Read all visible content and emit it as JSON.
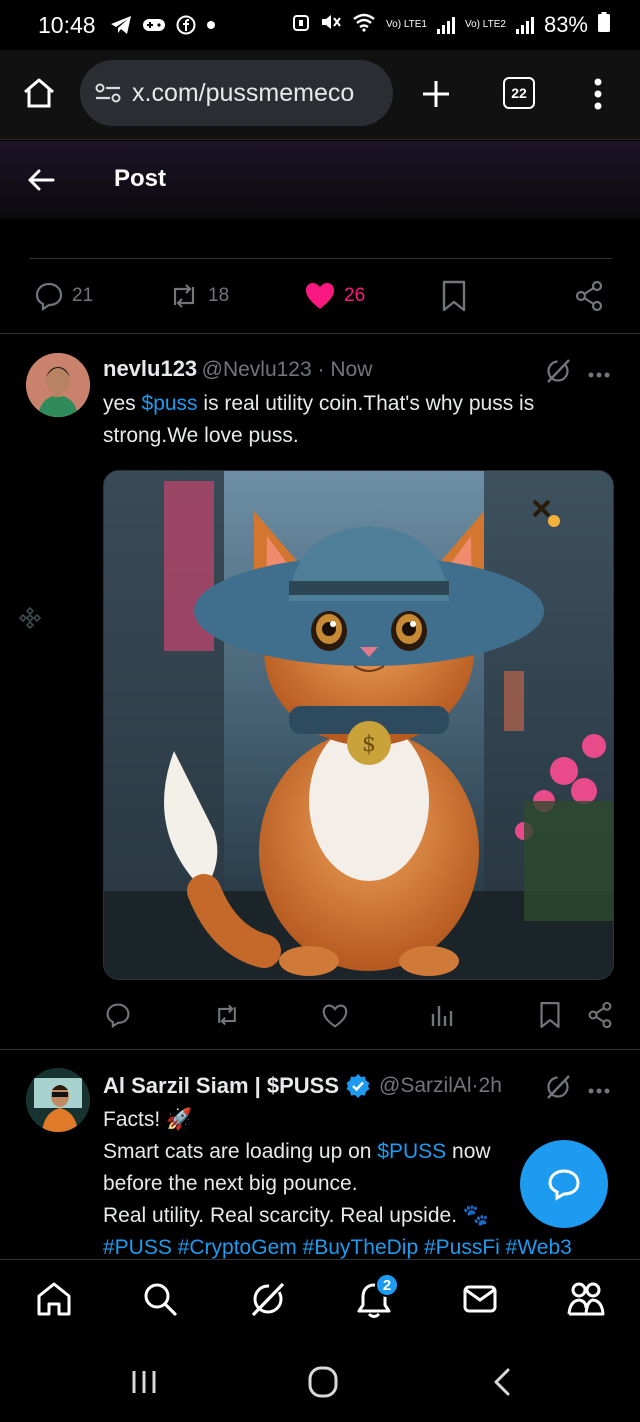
{
  "status": {
    "time": "10:48",
    "net1": "Vo) LTE1",
    "net2": "Vo) LTE2",
    "battery": "83%"
  },
  "browser": {
    "url": "x.com/pussmemeco",
    "tab_count": "22"
  },
  "post_header": {
    "title": "Post"
  },
  "main_post_actions": {
    "replies": "21",
    "reposts": "18",
    "likes": "26",
    "like_color": "#f91880"
  },
  "replies": [
    {
      "name": "nevlu123",
      "handle": "@Nevlu123",
      "time": "Now",
      "text_prefix": "yes ",
      "cashtag": "$puss",
      "text_suffix": " is real utility coin.That's why puss is strong.We love puss."
    },
    {
      "name": "Al Sarzil Siam | $PUSS",
      "handle": "@SarzilAl",
      "time": "2h",
      "line1": "Facts! 🚀",
      "line2_prefix": "Smart cats are loading up on ",
      "line2_cashtag": "$PUSS",
      "line2_suffix": " now",
      "line3": "before the next big pounce.",
      "line4": "Real utility. Real scarcity. Real upside. 🐾",
      "hashtags": "#PUSS #CryptoGem #BuyTheDip #PussFi #Web3"
    }
  ],
  "bottom_nav": {
    "notif_badge": "2"
  },
  "colors": {
    "accent": "#1d9bf0",
    "verified": "#1d9bf0"
  }
}
